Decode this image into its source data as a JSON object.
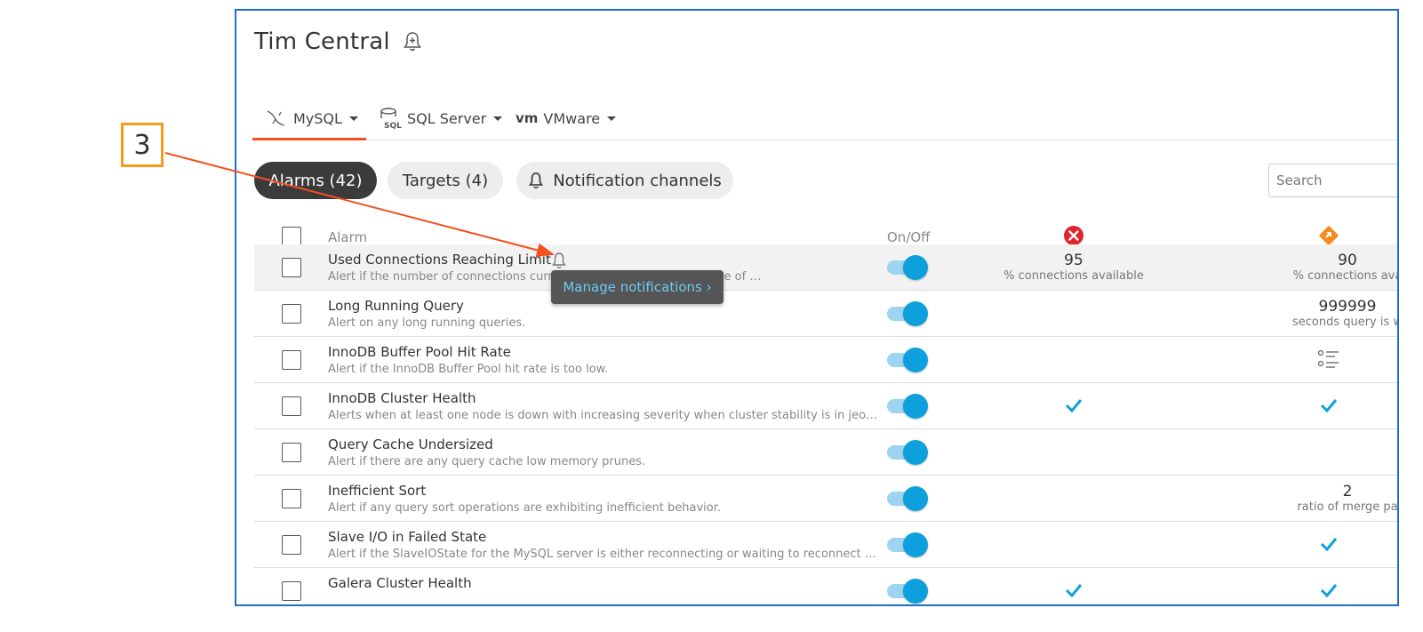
{
  "header": {
    "title": "Tim Central"
  },
  "tabs": [
    {
      "label": "MySQL",
      "icon": "mysql-dolphin-icon"
    },
    {
      "label": "SQL Server",
      "icon": "sql-database-icon"
    },
    {
      "label": "VMware",
      "icon": "vm-logo-icon",
      "logo_text": "vm"
    }
  ],
  "pills": {
    "alarms": "Alarms (42)",
    "targets": "Targets (4)",
    "notifications": "Notification channels"
  },
  "search": {
    "placeholder": "Search"
  },
  "table": {
    "col_alarm": "Alarm",
    "col_onoff": "On/Off",
    "severity_icons": [
      "critical-x-icon",
      "warning-diamond-icon"
    ],
    "rows": [
      {
        "name": "Used Connections Reaching Limit",
        "desc": "Alert if the number of connections current… too high as a percentage of …",
        "on": true,
        "c1_value": "95",
        "c1_unit": "% connections available",
        "c2_value": "90",
        "c2_unit": "% connections ava"
      },
      {
        "name": "Long Running Query",
        "desc": "Alert on any long running queries.",
        "on": true,
        "c2_value": "999999",
        "c2_unit": "seconds query is w"
      },
      {
        "name": "InnoDB Buffer Pool Hit Rate",
        "desc": "Alert if the InnoDB Buffer Pool hit rate is too low.",
        "on": true,
        "c2_icon": "list-settings-icon"
      },
      {
        "name": "InnoDB Cluster Health",
        "desc": "Alerts when at least one node is down with increasing severity when cluster stability is in jeopardy.",
        "on": true,
        "c1_icon": "checkmark-icon",
        "c2_icon": "checkmark-icon"
      },
      {
        "name": "Query Cache Undersized",
        "desc": "Alert if there are any query cache low memory prunes.",
        "on": true
      },
      {
        "name": "Inefficient Sort",
        "desc": "Alert if any query sort operations are exhibiting inefficient behavior.",
        "on": true,
        "c2_value": "2",
        "c2_unit": "ratio of merge pa"
      },
      {
        "name": "Slave I/O in Failed State",
        "desc": "Alert if the SlaveIOState for the MySQL server is either reconnecting or waiting to reconnect after a d…",
        "on": true,
        "c2_icon": "checkmark-icon"
      },
      {
        "name": "Galera Cluster Health",
        "desc": "",
        "on": true,
        "c1_icon": "checkmark-icon",
        "c2_icon": "checkmark-icon"
      }
    ]
  },
  "tooltip": {
    "label": "Manage notifications ›"
  },
  "callout": {
    "number": "3"
  },
  "colors": {
    "accent_tab": "#f4511e",
    "toggle": "#0ea0dc",
    "critical": "#e0242e",
    "warning": "#f58a1f",
    "callout_border": "#f59a1b",
    "frame_border": "#1f6fc5"
  }
}
